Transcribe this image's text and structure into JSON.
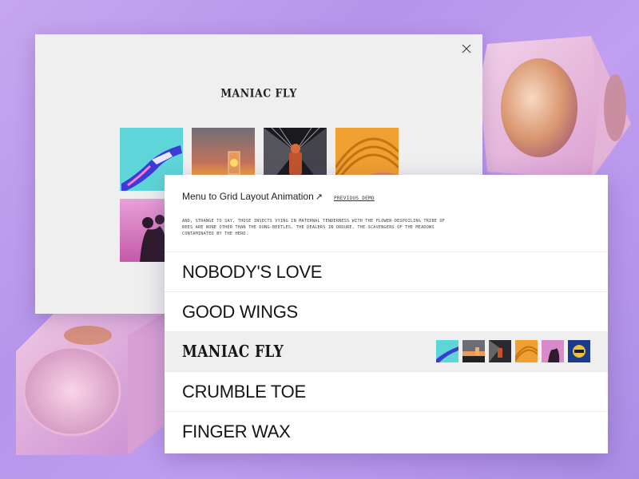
{
  "grid_window": {
    "title": "MANIAC FLY",
    "close_icon": "close-icon",
    "images": [
      {
        "name": "grid-image-hand"
      },
      {
        "name": "grid-image-sunset-portal"
      },
      {
        "name": "grid-image-astronaut-tunnel"
      },
      {
        "name": "grid-image-orange-arcs"
      },
      {
        "name": "grid-image-couple"
      }
    ]
  },
  "menu_window": {
    "title": "Menu to Grid Layout Animation",
    "title_arrow": "↗",
    "previous_demo": "PREVIOUS DEMO",
    "description": "AND, STRANGE TO SAY, THOSE INSECTS VYING IN MATERNAL TENDERNESS WITH THE FLOWER-DESPOILING TRIBE OF BEES ARE NONE OTHER THAN THE DUNG-BEETLES, THE DEALERS IN ORDURE, THE SCAVENGERS OF THE MEADOWS CONTAMINATED BY THE HERD.",
    "items": [
      {
        "label": "NOBODY'S LOVE"
      },
      {
        "label": "GOOD WINGS"
      },
      {
        "label": "MANIAC FLY"
      },
      {
        "label": "CRUMBLE TOE"
      },
      {
        "label": "FINGER WAX"
      }
    ]
  },
  "colors": {
    "background": "#c3a4ee",
    "window_bg": "#efefef",
    "menu_bg": "#ffffff",
    "active_row": "#efefef",
    "text": "#151515"
  }
}
